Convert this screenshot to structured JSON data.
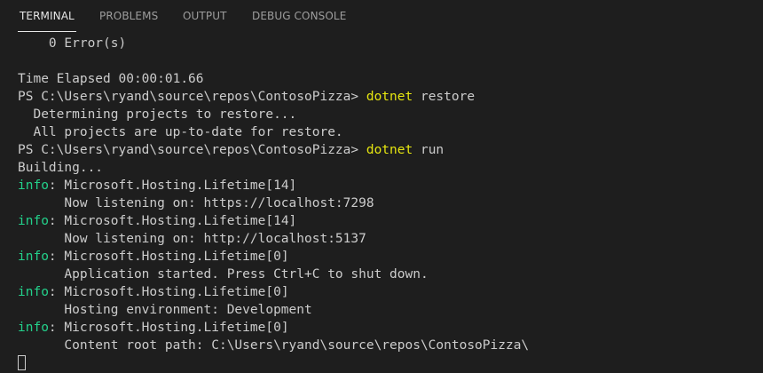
{
  "tabs": [
    {
      "label": "TERMINAL",
      "active": true
    },
    {
      "label": "PROBLEMS",
      "active": false
    },
    {
      "label": "OUTPUT",
      "active": false
    },
    {
      "label": "DEBUG CONSOLE",
      "active": false
    }
  ],
  "terminal": {
    "colors": {
      "text": "#cccccc",
      "command": "#e5e510",
      "info": "#23d18b",
      "background": "#1e1e1e"
    },
    "lines": [
      {
        "text": "    0 Error(s)"
      },
      {
        "text": ""
      },
      {
        "text": "Time Elapsed 00:00:01.66"
      },
      {
        "prompt": "PS C:\\Users\\ryand\\source\\repos\\ContosoPizza> ",
        "cmd": "dotnet",
        "args": " restore"
      },
      {
        "text": "  Determining projects to restore..."
      },
      {
        "text": "  All projects are up-to-date for restore."
      },
      {
        "prompt": "PS C:\\Users\\ryand\\source\\repos\\ContosoPizza> ",
        "cmd": "dotnet",
        "args": " run"
      },
      {
        "text": "Building..."
      },
      {
        "level": "info",
        "text": ": Microsoft.Hosting.Lifetime[14]"
      },
      {
        "text": "      Now listening on: https://localhost:7298"
      },
      {
        "level": "info",
        "text": ": Microsoft.Hosting.Lifetime[14]"
      },
      {
        "text": "      Now listening on: http://localhost:5137"
      },
      {
        "level": "info",
        "text": ": Microsoft.Hosting.Lifetime[0]"
      },
      {
        "text": "      Application started. Press Ctrl+C to shut down."
      },
      {
        "level": "info",
        "text": ": Microsoft.Hosting.Lifetime[0]"
      },
      {
        "text": "      Hosting environment: Development"
      },
      {
        "level": "info",
        "text": ": Microsoft.Hosting.Lifetime[0]"
      },
      {
        "text": "      Content root path: C:\\Users\\ryand\\source\\repos\\ContosoPizza\\"
      }
    ]
  }
}
